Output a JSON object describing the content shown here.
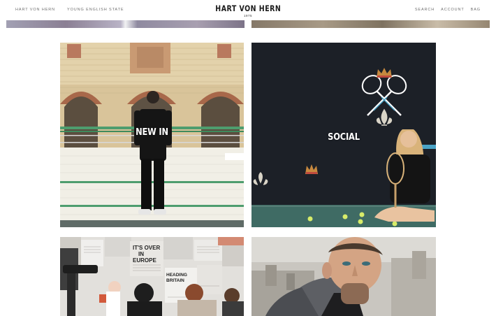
{
  "header": {
    "nav_left": [
      "HART VON HERN",
      "YOUNG ENGLISH STATE"
    ],
    "brand": "HART VON HERN",
    "brand_year": "1975",
    "nav_right": [
      "SEARCH",
      "ACCOUNT",
      "BAG"
    ]
  },
  "tiles": {
    "new_in": {
      "label": "NEW IN"
    },
    "social": {
      "label": "SOCIAL"
    },
    "press": {
      "label": "",
      "headlines": [
        "IT'S OVER IN EUROPE",
        "HEADING BRITAIN"
      ]
    },
    "portrait": {
      "label": ""
    }
  },
  "colors": {
    "background": "#ffffff",
    "nav_text": "#6f6f6f",
    "brand_text": "#1a1a1a",
    "label_text": "#ffffff",
    "court_wall": "#1c2027",
    "court_floor": "#3f6b64",
    "tennis_ball": "#d7ec6a",
    "crown": "#c7893f",
    "racket": "#ffffff"
  },
  "icons": [
    "crossed-rackets-icon",
    "crown-icon",
    "fleur-de-lis-icon"
  ]
}
